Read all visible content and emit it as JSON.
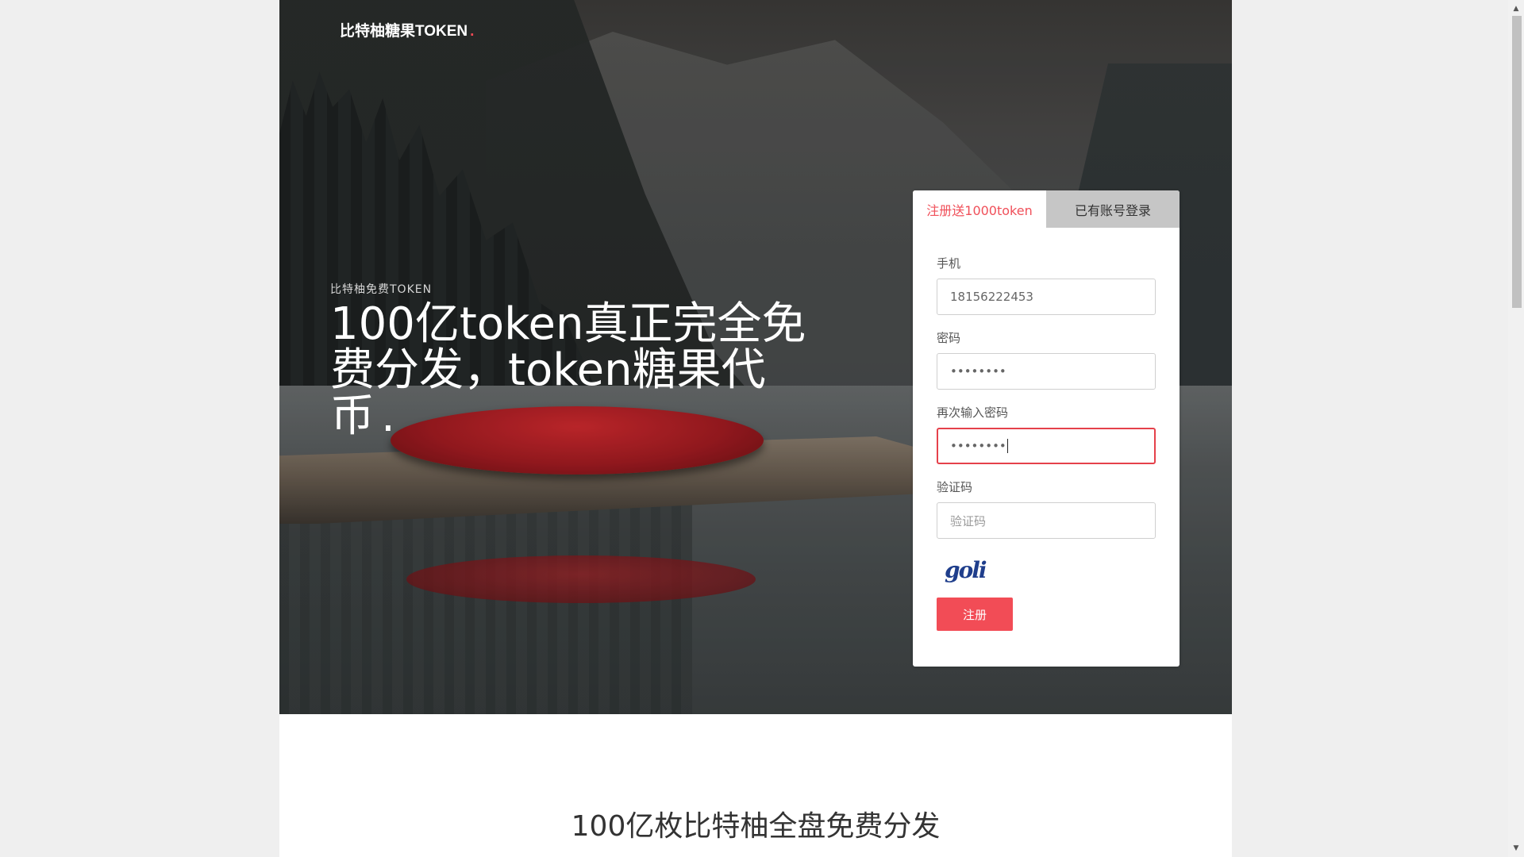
{
  "header": {
    "brand": "比特柚糖果TOKEN",
    "brand_dot": "."
  },
  "hero": {
    "subtitle": "比特柚免费TOKEN",
    "title": "100亿token真正完全免费分发，token糖果代币",
    "title_dot": "."
  },
  "register_card": {
    "tabs": [
      {
        "label": "注册送1000token",
        "active": true
      },
      {
        "label": "已有账号登录",
        "active": false
      }
    ],
    "fields": {
      "phone": {
        "label": "手机",
        "value": "18156222453"
      },
      "password": {
        "label": "密码",
        "value": "••••••••"
      },
      "confirm_password": {
        "label": "再次输入密码",
        "value": "••••••••"
      },
      "captcha": {
        "label": "验证码",
        "placeholder": "验证码"
      }
    },
    "captcha_image_text": "goli",
    "submit_label": "注册"
  },
  "section": {
    "title": "100亿枚比特柚全盘免费分发"
  },
  "colors": {
    "accent": "#f24c56",
    "tab_inactive": "#c6c6c6",
    "page_bg": "#efefef"
  },
  "icons": {
    "scroll_up": "triangle-up-icon",
    "scroll_down": "triangle-down-icon"
  }
}
